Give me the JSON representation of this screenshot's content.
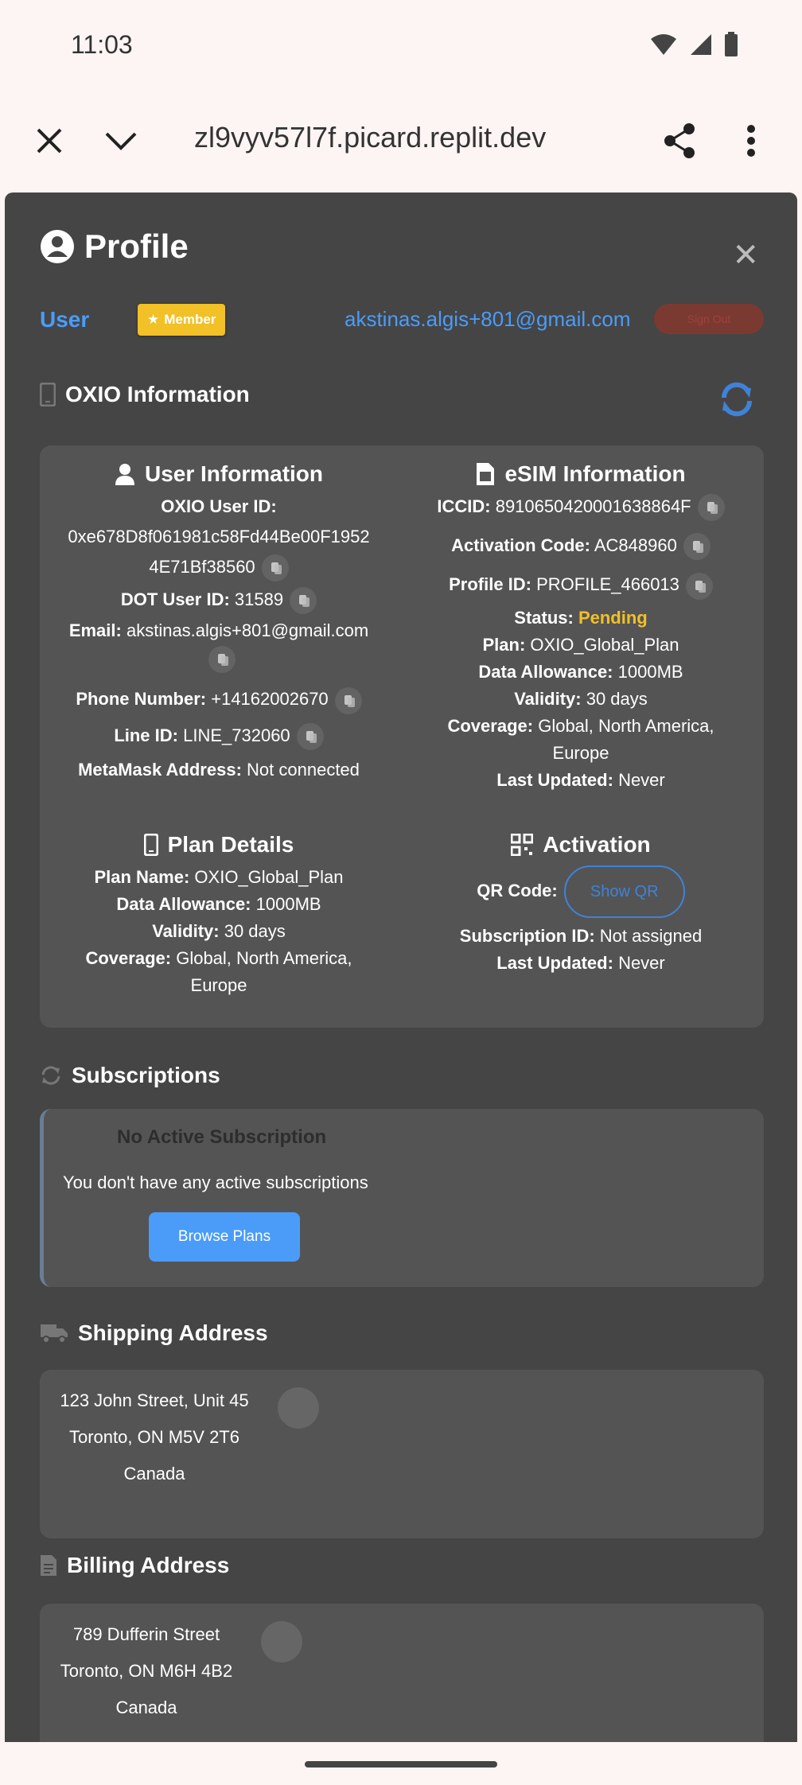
{
  "status_bar": {
    "time": "11:03"
  },
  "browser": {
    "url": "zl9vyv57l7f.picard.replit.dev"
  },
  "modal": {
    "title": "Profile",
    "role": "User",
    "badge": "Member",
    "email": "akstinas.algis+801@gmail.com",
    "logout_label": "Sign Out"
  },
  "oxio": {
    "heading": "OXIO Information",
    "user_info": {
      "heading": "User Information",
      "oxio_user_id_label": "OXIO User ID:",
      "oxio_user_id_line1": "0xe678D8f061981c58Fd44Be00F1952",
      "oxio_user_id_line2": "4E71Bf38560",
      "dot_user_id_label": "DOT User ID:",
      "dot_user_id": "31589",
      "email_label": "Email:",
      "email": "akstinas.algis+801@gmail.com",
      "phone_label": "Phone Number:",
      "phone": "+14162002670",
      "line_id_label": "Line ID:",
      "line_id": "LINE_732060",
      "metamask_label": "MetaMask Address:",
      "metamask": "Not connected"
    },
    "esim": {
      "heading": "eSIM Information",
      "iccid_label": "ICCID:",
      "iccid": "8910650420001638864F",
      "activation_code_label": "Activation Code:",
      "activation_code": "AC848960",
      "profile_id_label": "Profile ID:",
      "profile_id": "PROFILE_466013",
      "status_label": "Status:",
      "status": "Pending",
      "plan_label": "Plan:",
      "plan": "OXIO_Global_Plan",
      "data_label": "Data Allowance:",
      "data": "1000MB",
      "validity_label": "Validity:",
      "validity": "30 days",
      "coverage_label": "Coverage:",
      "coverage_line1": "Global, North America,",
      "coverage_line2": "Europe",
      "updated_label": "Last Updated:",
      "updated": "Never"
    },
    "plan_details": {
      "heading": "Plan Details",
      "plan_name_label": "Plan Name:",
      "plan_name": "OXIO_Global_Plan",
      "data_label": "Data Allowance:",
      "data": "1000MB",
      "validity_label": "Validity:",
      "validity": "30 days",
      "coverage_label": "Coverage:",
      "coverage_line1": "Global, North America,",
      "coverage_line2": "Europe"
    },
    "activation": {
      "heading": "Activation",
      "qr_label": "QR Code:",
      "qr_button": "Show QR",
      "sub_id_label": "Subscription ID:",
      "sub_id": "Not assigned",
      "updated_label": "Last Updated:",
      "updated": "Never"
    }
  },
  "subscriptions": {
    "heading": "Subscriptions",
    "empty_title": "No Active Subscription",
    "empty_desc": "You don't have any active subscriptions",
    "browse_label": "Browse Plans"
  },
  "shipping": {
    "heading": "Shipping Address",
    "line1": "123 John Street, Unit 45",
    "line2": "Toronto, ON M5V 2T6",
    "line3": "Canada"
  },
  "billing": {
    "heading": "Billing Address",
    "line1": "789 Dufferin Street",
    "line2": "Toronto, ON M6H 4B2",
    "line3": "Canada"
  },
  "colors": {
    "accent": "#4a9cf8",
    "badge": "#f2c027",
    "pending": "#f2c027",
    "panel": "#545454",
    "modal": "#454545"
  }
}
